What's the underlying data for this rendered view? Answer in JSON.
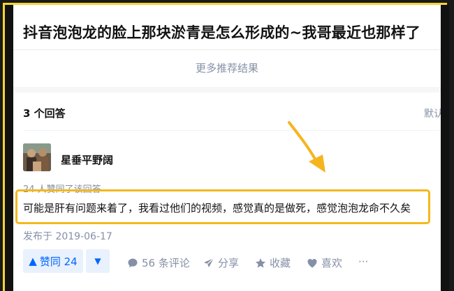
{
  "question": {
    "title": "抖音泡泡龙的脸上那块淤青是怎么形成的~我哥最近也那样了"
  },
  "more_results": "更多推荐结果",
  "answers_header": {
    "count_label": "3 个回答",
    "sort_label": "默认"
  },
  "answer": {
    "author": "星垂平野阔",
    "agree_info": "24 人赞同了该回答",
    "content": "可能是肝有问题来着了，我看过他们的视频，感觉真的是做死，感觉泡泡龙命不久矣",
    "published": "发布于 2019-06-17",
    "actions": {
      "upvote_label": "赞同 24",
      "comments_label": "56 条评论",
      "share_label": "分享",
      "collect_label": "收藏",
      "like_label": "喜欢",
      "more_label": "···"
    }
  },
  "colors": {
    "highlight": "#f3b81d",
    "frame": "#f3d534",
    "accent": "#0066ff",
    "muted": "#8590a6"
  },
  "icons": [
    "triangle-up-icon",
    "triangle-down-icon",
    "comment-icon",
    "share-icon",
    "star-icon",
    "heart-icon",
    "more-icon"
  ]
}
